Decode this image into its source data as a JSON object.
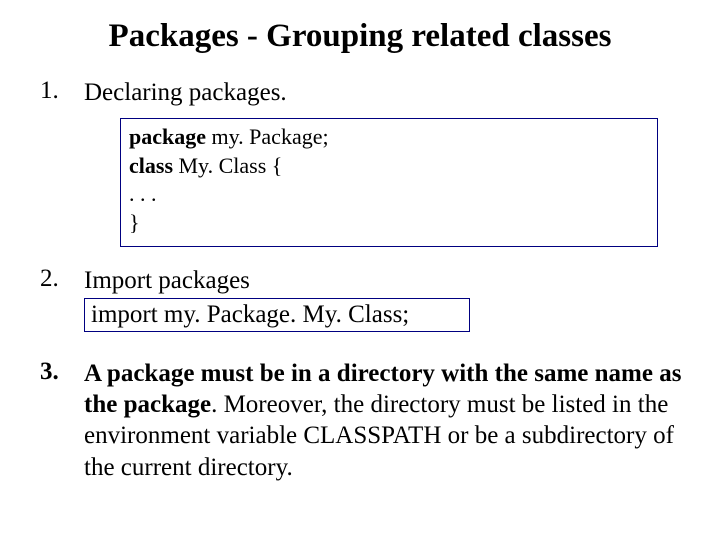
{
  "title": "Packages - Grouping related classes",
  "items": {
    "n1": "1.",
    "heading1": "Declaring packages.",
    "code": {
      "kw_package": "package",
      "pkgname": " my. Package;",
      "kw_class": "class",
      "classname": " My. Class {",
      "ellipsis": "  . . .",
      "close": "}"
    },
    "n2": "2.",
    "heading2": "Import packages",
    "import_line": "import   my. Package. My. Class;",
    "n3": "3.",
    "heading3_bold": "A package must be in a directory with the same name as the package",
    "heading3_rest": ". Moreover, the directory must be listed in the environment variable CLASSPATH or be a subdirectory of the current directory."
  }
}
